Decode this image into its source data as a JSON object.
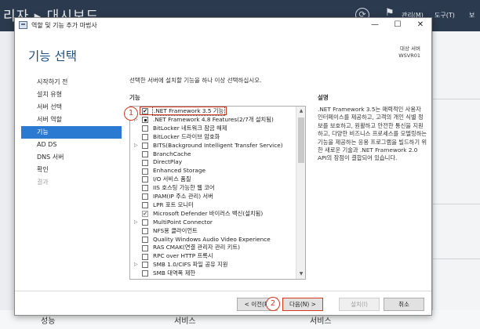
{
  "background": {
    "title": "리자 ▸ 대시보드",
    "menu": [
      "관리(M)",
      "도구(T)",
      "보"
    ],
    "bottom_labels": [
      "성능",
      "서비스",
      "서비스"
    ]
  },
  "window": {
    "title": "역할 및 기능 추가 마법사",
    "controls": {
      "minimize": "—",
      "maximize": "☐",
      "close": "✕"
    }
  },
  "page": {
    "heading": "기능 선택",
    "server_caption": "대상 서버",
    "server_name": "WSVR01",
    "instruction": "선택한 서버에 설치할 기능을 하나 이상 선택하십시오.",
    "features_header": "기능",
    "description_header": "설명",
    "description": ".NET Framework 3.5는 매력적인 사용자 인터페이스를 제공하고, 고객의 개인 식별 정보를 보호하고, 원활하고 안전한 통신을 지원하고, 다양한 비즈니스 프로세스를 모델링하는 기능을 제공하는 응용 프로그램을 빌드하기 위한 새로운 기술과 .NET Framework 2.0 API의 장점이 결합되어 있습니다."
  },
  "nav": [
    {
      "label": "시작하기 전",
      "state": "normal"
    },
    {
      "label": "설치 유형",
      "state": "normal"
    },
    {
      "label": "서버 선택",
      "state": "normal"
    },
    {
      "label": "서버 역할",
      "state": "normal"
    },
    {
      "label": "기능",
      "state": "active"
    },
    {
      "label": "AD DS",
      "state": "normal"
    },
    {
      "label": "DNS 서버",
      "state": "normal"
    },
    {
      "label": "확인",
      "state": "normal"
    },
    {
      "label": "결과",
      "state": "disabled"
    }
  ],
  "features": [
    {
      "label": ".NET Framework 3.5 기능",
      "check": "checked",
      "expandable": true
    },
    {
      "label": ".NET Framework 4.8 Features(2/7개 설치됨)",
      "check": "partial",
      "expandable": true
    },
    {
      "label": "BitLocker 네트워크 잠금 해제",
      "check": "none",
      "expandable": false
    },
    {
      "label": "BitLocker 드라이브 암호화",
      "check": "none",
      "expandable": false
    },
    {
      "label": "BITS(Background Intelligent Transfer Service)",
      "check": "none",
      "expandable": true
    },
    {
      "label": "BranchCache",
      "check": "none",
      "expandable": false
    },
    {
      "label": "DirectPlay",
      "check": "none",
      "expandable": false
    },
    {
      "label": "Enhanced Storage",
      "check": "none",
      "expandable": false
    },
    {
      "label": "I/O 서비스 품질",
      "check": "none",
      "expandable": false
    },
    {
      "label": "IIS 호스팅 가능한 웹 코어",
      "check": "none",
      "expandable": false
    },
    {
      "label": "IPAM(IP 주소 관리) 서버",
      "check": "none",
      "expandable": false
    },
    {
      "label": "LPR 포트 모니터",
      "check": "none",
      "expandable": false
    },
    {
      "label": "Microsoft Defender 바이러스 백신(설치됨)",
      "check": "grayed-checked",
      "expandable": false
    },
    {
      "label": "MultiPoint Connector",
      "check": "none",
      "expandable": true
    },
    {
      "label": "NFS용 클라이언트",
      "check": "none",
      "expandable": false
    },
    {
      "label": "Quality Windows Audio Video Experience",
      "check": "none",
      "expandable": false
    },
    {
      "label": "RAS CMAK(연결 관리자 관리 키트)",
      "check": "none",
      "expandable": false
    },
    {
      "label": "RPC over HTTP 프록시",
      "check": "none",
      "expandable": false
    },
    {
      "label": "SMB 1.0/CIFS 파일 공유 지원",
      "check": "none",
      "expandable": true
    },
    {
      "label": "SMB 대역폭 제한",
      "check": "none",
      "expandable": false
    }
  ],
  "buttons": {
    "prev": "< 이전(P)",
    "next": "다음(N) >",
    "install": "설치(I)",
    "cancel": "취소"
  },
  "annotations": {
    "step1": "1",
    "step2": "2"
  },
  "colors": {
    "accent": "#2a7ad2",
    "heading": "#1a4f86",
    "annotation": "#d9381e"
  }
}
